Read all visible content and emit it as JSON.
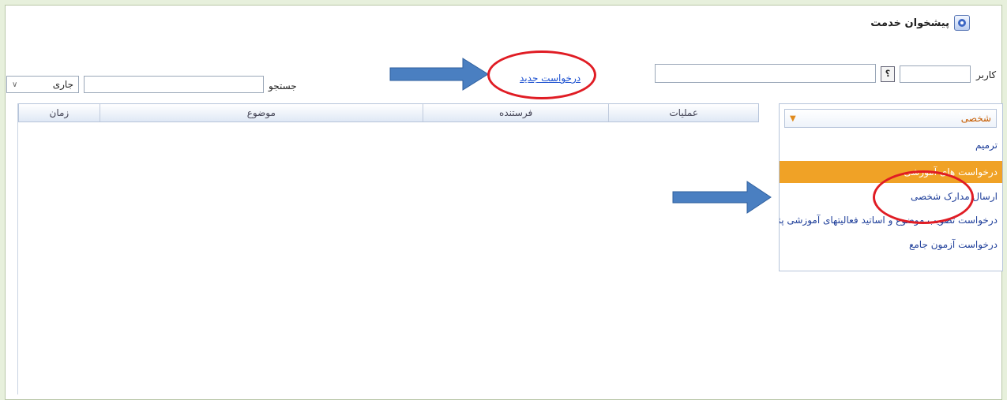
{
  "window": {
    "title": "پیشخوان خدمت"
  },
  "toolbar": {
    "user_label": "کاربر",
    "user_input_value": "",
    "user_lookup_label": "؟",
    "new_request_link": "درخواست جدید",
    "search_label": "جستجو",
    "search_value": "",
    "status_select_value": "جاری"
  },
  "grid": {
    "columns": [
      "عملیات",
      "فرستنده",
      "موضوع",
      "زمان"
    ],
    "rows": []
  },
  "side_panel": {
    "dropdown_value": "شخصی",
    "items": [
      "ترمیم",
      "درخواست های آموزشی",
      "ارسال مدارک شخصی",
      "درخواست تصویب موضوع و اساتید فعالیتهای آموزشی پژوهشی",
      "درخواست آزمون جامع"
    ],
    "selected_index": 1
  },
  "colors": {
    "selected_item": "#f0a226",
    "annotation_arrow": "#4a7fc1",
    "annotation_circle": "#e01c24",
    "link": "#1a4fd0"
  }
}
